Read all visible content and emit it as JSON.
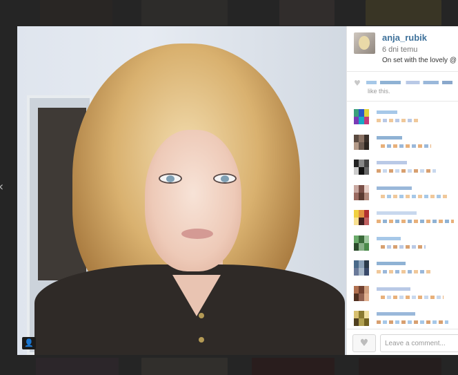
{
  "post": {
    "username": "anja_rubik",
    "time_ago": "6 dni temu",
    "caption": "On set with the lovely @",
    "likes_suffix": "like this."
  },
  "comment_box": {
    "placeholder": "Leave a comment...",
    "value": ""
  },
  "icons": {
    "like_button": "heart-icon",
    "likes_marker": "heart-icon",
    "usertag": "user-icon",
    "nav_left": "chevron-left-icon"
  },
  "glyphs": {
    "heart": "♥",
    "user": "👤",
    "chevron_left": "‹"
  },
  "colors": {
    "username": "#3f729b",
    "meta_text": "#777777",
    "backdrop": "#3a3a3a"
  },
  "comments": [
    {
      "avatar": [
        "#3aa07a",
        "#2b58c7",
        "#e0d23a",
        "#7a3ab6",
        "#19a9c5",
        "#c33a7a"
      ]
    },
    {
      "avatar": [
        "#5a4a40",
        "#8a7264",
        "#3a302a",
        "#b49a88",
        "#6b5a50",
        "#2c2520"
      ]
    },
    {
      "avatar": [
        "#222222",
        "#888888",
        "#444444",
        "#cccccc",
        "#111111",
        "#666666"
      ]
    },
    {
      "avatar": [
        "#c9a8a0",
        "#7a5048",
        "#e8d0c8",
        "#9a6a60",
        "#5a3a30",
        "#b0887a"
      ]
    },
    {
      "avatar": [
        "#f0d040",
        "#e09040",
        "#b03030",
        "#f8e090",
        "#402020",
        "#c06060"
      ]
    },
    {
      "avatar": [
        "#6aaa6a",
        "#3a6a3a",
        "#a0c8a0",
        "#2a4a2a",
        "#88b088",
        "#4a8a4a"
      ]
    },
    {
      "avatar": [
        "#4a6a8a",
        "#8aa0b8",
        "#2a3a4a",
        "#6a7a9a",
        "#a8b8c8",
        "#3a4a6a"
      ]
    },
    {
      "avatar": [
        "#b07050",
        "#704030",
        "#d0a080",
        "#503020",
        "#906050",
        "#e0b090"
      ]
    },
    {
      "avatar": [
        "#d8c070",
        "#8a7a30",
        "#f0e0a0",
        "#504020",
        "#b0a050",
        "#706020"
      ]
    }
  ]
}
